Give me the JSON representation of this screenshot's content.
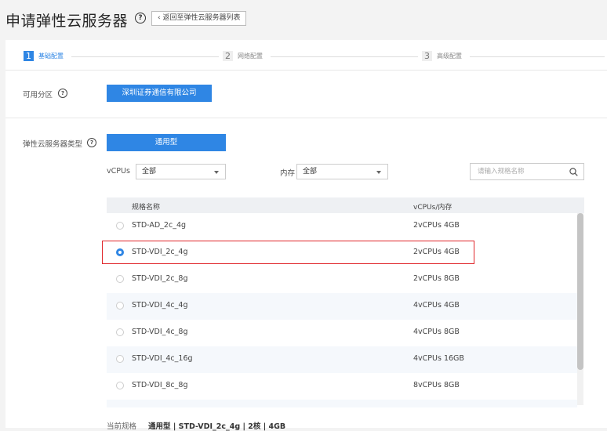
{
  "header": {
    "title": "申请弹性云服务器",
    "help": "?",
    "back_button": "‹ 返回至弹性云服务器列表"
  },
  "steps": [
    {
      "num": "1",
      "label": "基础配置",
      "active": true
    },
    {
      "num": "2",
      "label": "网络配置",
      "active": false
    },
    {
      "num": "3",
      "label": "高级配置",
      "active": false
    }
  ],
  "zone": {
    "label": "可用分区",
    "help": "?",
    "value": "深圳证券通信有限公司"
  },
  "type": {
    "label": "弹性云服务器类型",
    "help": "?",
    "value": "通用型"
  },
  "filters": {
    "vcpus_label": "vCPUs",
    "vcpus_value": "全部",
    "memory_label": "内存",
    "memory_value": "全部",
    "search_placeholder": "请输入规格名称"
  },
  "table": {
    "col_name": "规格名称",
    "col_spec": "vCPUs/内存",
    "rows": [
      {
        "name": "STD-AD_2c_4g",
        "spec": "2vCPUs 4GB",
        "selected": false
      },
      {
        "name": "STD-VDI_2c_4g",
        "spec": "2vCPUs 4GB",
        "selected": true
      },
      {
        "name": "STD-VDI_2c_8g",
        "spec": "2vCPUs 8GB",
        "selected": false
      },
      {
        "name": "STD-VDI_4c_4g",
        "spec": "4vCPUs 4GB",
        "selected": false
      },
      {
        "name": "STD-VDI_4c_8g",
        "spec": "4vCPUs 8GB",
        "selected": false
      },
      {
        "name": "STD-VDI_4c_16g",
        "spec": "4vCPUs 16GB",
        "selected": false
      },
      {
        "name": "STD-VDI_8c_8g",
        "spec": "8vCPUs 8GB",
        "selected": false
      }
    ]
  },
  "footer": {
    "label": "当前规格",
    "value": "通用型 | STD-VDI_2c_4g | 2核 | 4GB"
  },
  "colors": {
    "accent": "#2f86e4",
    "highlight": "#e0262a"
  }
}
